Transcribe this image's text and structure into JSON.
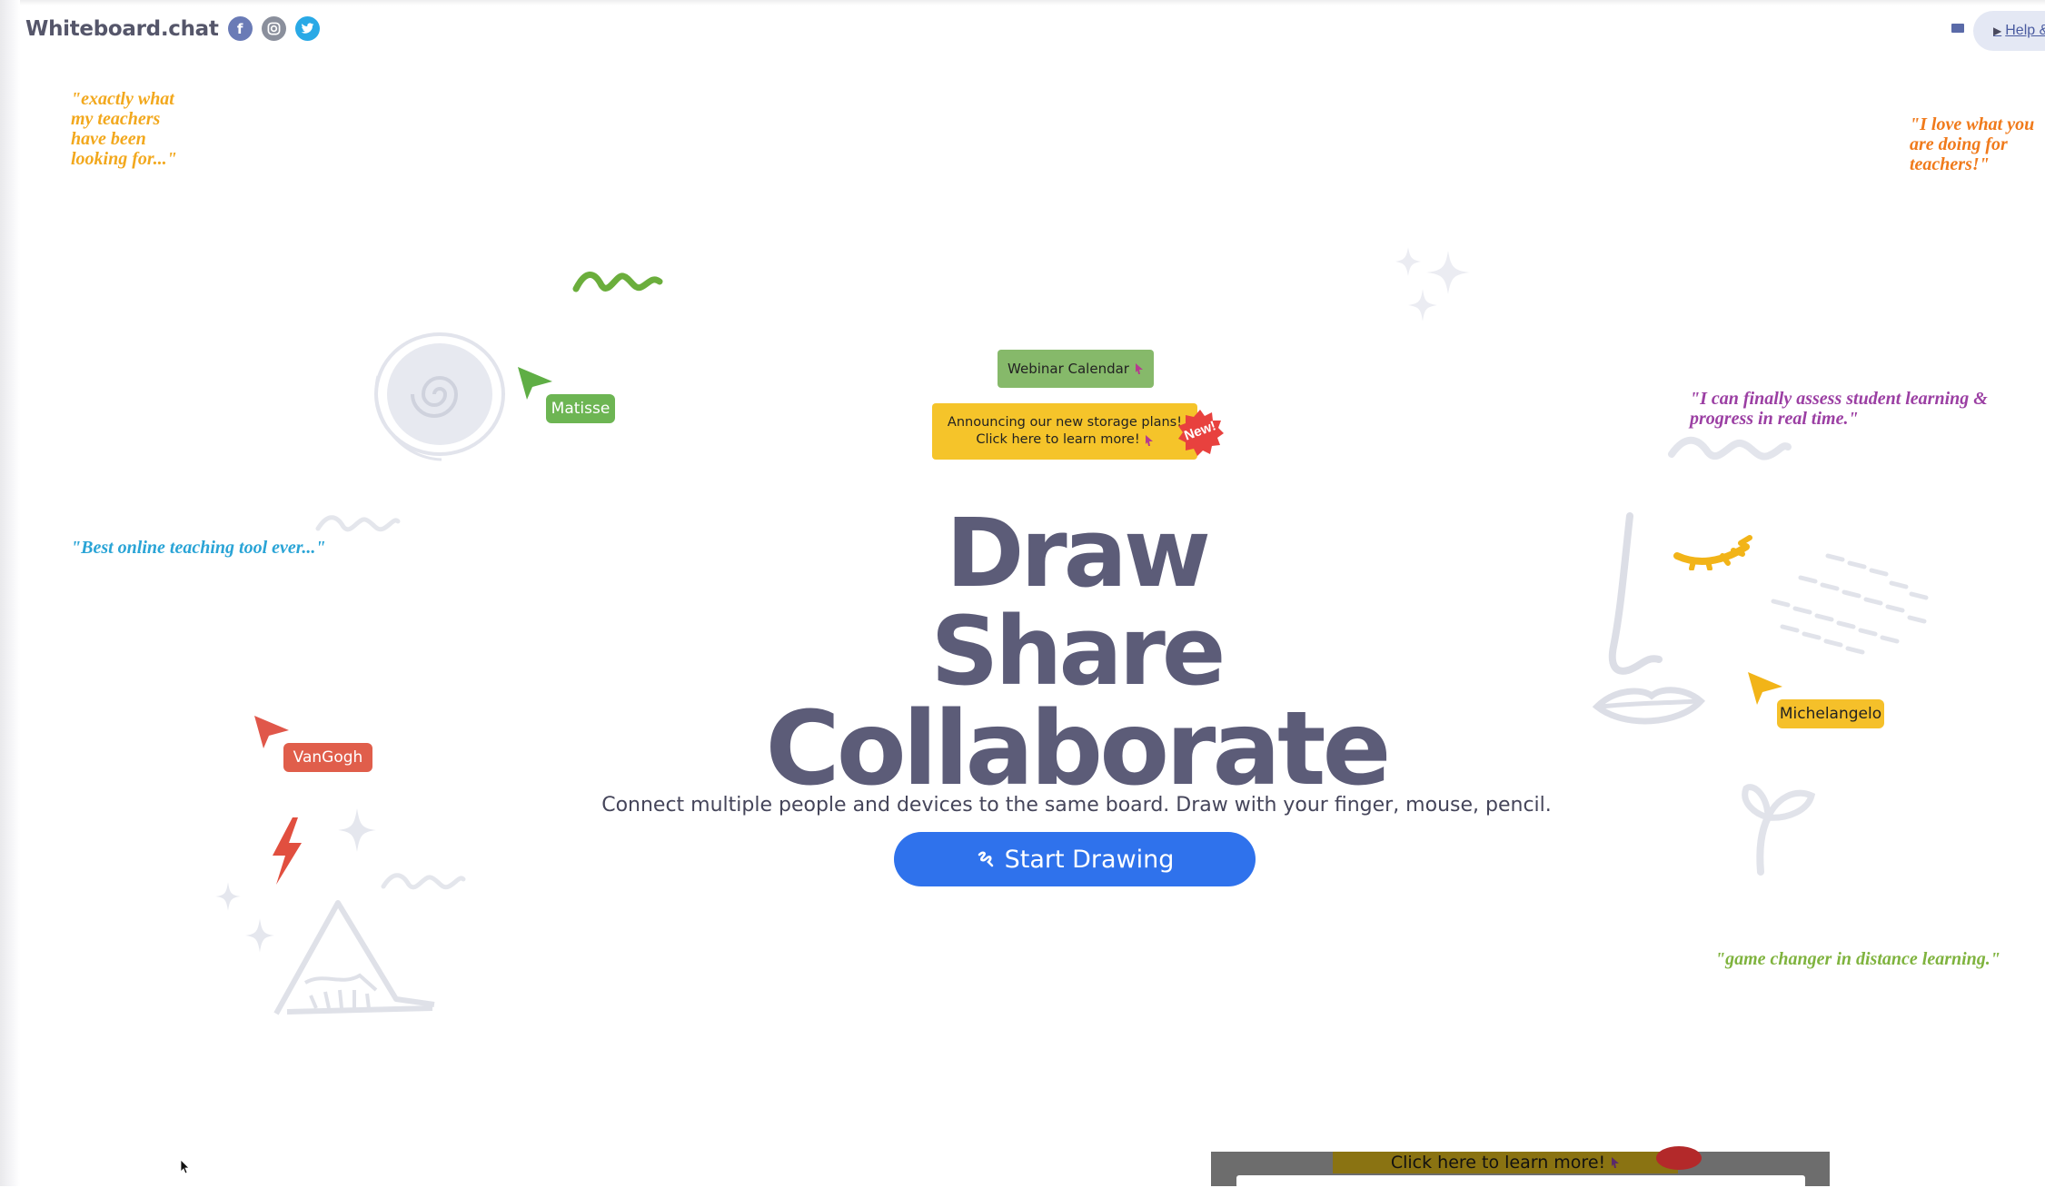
{
  "header": {
    "brand": "Whiteboard.chat",
    "social": [
      {
        "name": "facebook-icon",
        "glyph": "f"
      },
      {
        "name": "instagram-icon",
        "glyph": "◎"
      },
      {
        "name": "twitter-icon",
        "glyph": "✦"
      }
    ],
    "help_label": "Help &"
  },
  "quotes": {
    "q1": "\"exactly what my teachers have been looking for...\"",
    "q2": "\"I love what you are doing for teachers!\"",
    "q3": "\"I can finally assess student learning & progress in real time.\"",
    "q4": "\"Best online teaching tool ever...\"",
    "q5": "\"game changer in distance learning.\""
  },
  "cursors": {
    "matisse": "Matisse",
    "vangogh": "VanGogh",
    "michelangelo": "Michelangelo"
  },
  "announcements": {
    "webinar": "Webinar Calendar",
    "storage_line1": "Announcing our new storage plans!",
    "storage_line2": "Click here to learn more!",
    "new_badge": "New!"
  },
  "hero": {
    "line1": "Draw",
    "line2": "Share",
    "line3": "Collaborate",
    "subtitle": "Connect multiple people and devices to the same board. Draw with your finger, mouse, pencil.",
    "cta": "Start Drawing"
  },
  "bottom_popup": {
    "text": "Click here to learn more!"
  },
  "colors": {
    "accent_blue": "#2f72ec",
    "webinar_green": "#86b96a",
    "storage_yellow": "#f5c42a",
    "badge_red": "#e8413e"
  }
}
